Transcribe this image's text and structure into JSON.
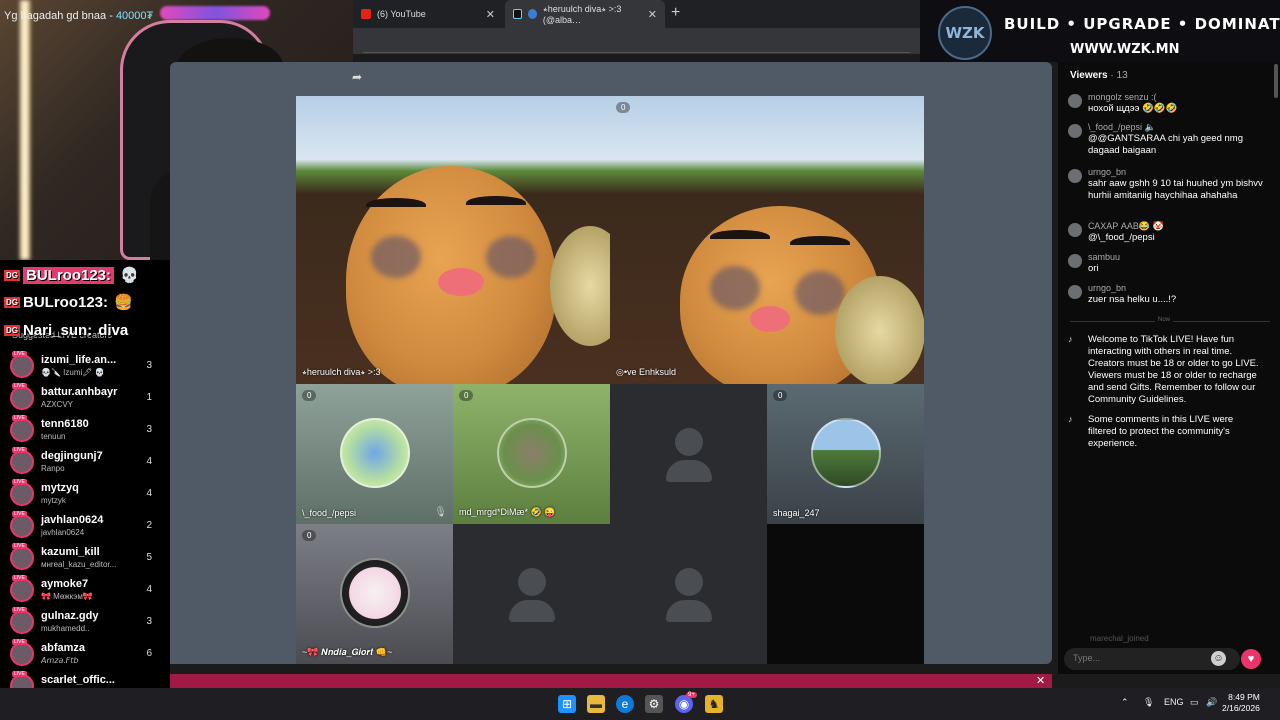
{
  "browser": {
    "tabs": [
      {
        "label": "(6) YouTube",
        "close": "✕"
      },
      {
        "label": "⭒heruulch diva⭒ >:3 (@alba…",
        "close": "✕"
      }
    ],
    "new_tab": "+"
  },
  "overlay": {
    "logo": "WZK",
    "slogan": "BUILD • UPGRADE • DOMINATE",
    "site": "WWW.WZK.MN",
    "donation_name": "Yg bagadah gd bnaa - ",
    "donation_amount": "40000₮"
  },
  "alerts": [
    {
      "badge": "DG",
      "name": "BULroo123:",
      "emote": "💀"
    },
    {
      "badge": "DG",
      "name": "BULroo123:",
      "emote": "🍔"
    },
    {
      "badge": "DG",
      "name": "Nari_sun:",
      "message": "diva"
    }
  ],
  "stage": {
    "main_tiles": [
      {
        "label": "⭒heruulch diva⭒ >:3",
        "count": ""
      },
      {
        "label": "◎•ve Enhksuld",
        "count": "0"
      }
    ],
    "guests": [
      {
        "label": "\\_food_/pepsi",
        "count": "0"
      },
      {
        "label": "md_mrgd*DiMæ* 🤣 😜",
        "count": "0"
      },
      {
        "label": "",
        "count": ""
      },
      {
        "label": "shagai_247",
        "count": "0"
      },
      {
        "label": "~🎀 𝑵𝒏𝒅𝒊𝒂_𝑮𝒊𝒐𝒓𝒕 👊~",
        "count": "0"
      },
      {
        "label": "",
        "count": ""
      },
      {
        "label": "",
        "count": ""
      },
      {
        "label": "",
        "count": ""
      }
    ]
  },
  "suggested": {
    "title": "Suggested LIVE creators",
    "live_badge": "LIVE",
    "creators": [
      {
        "name": "izumi_life.an...",
        "sub": "💀🔪 Izumi🖋 💀",
        "count": "3"
      },
      {
        "name": "battur.anhbayr",
        "sub": "AZXCVY",
        "count": "1"
      },
      {
        "name": "tenn6180",
        "sub": "tenuun",
        "count": "3"
      },
      {
        "name": "degjingunj7",
        "sub": "Ranpo",
        "count": "4"
      },
      {
        "name": "mytzyq",
        "sub": "mytzyk",
        "count": "4"
      },
      {
        "name": "javhlan0624",
        "sub": "javhlan0624",
        "count": "2"
      },
      {
        "name": "kazumi_kill",
        "sub": "мнreal_kazu_editor...",
        "count": "5"
      },
      {
        "name": "aymoke7",
        "sub": "🎀 Мөжкэм🎀",
        "count": "4"
      },
      {
        "name": "gulnaz.gdy",
        "sub": "mukhamedd..",
        "count": "3"
      },
      {
        "name": "abfamza",
        "sub": "𝘈𝘮𝘻𝘢.𝘍𝘵𝘣",
        "count": "6"
      },
      {
        "name": "scarlet_offic...",
        "sub": "",
        "count": ""
      }
    ]
  },
  "chat": {
    "viewers_label": "Viewers",
    "viewers_count": "· 13",
    "messages": [
      {
        "user": "mongolz senzu :(",
        "text": "нохой щдээ 🤣🤣🤣"
      },
      {
        "user": "\\_food_/pepsi 🔈",
        "text": "@@GANTSARAA chi yah geed nmg dagaad baigaan"
      },
      {
        "user": "urngo_bn",
        "text": "sahr aaw gshh 9 10 tai huuhed ym bishvv hurhii amitaniig haychihaa ahahaha"
      },
      {
        "user": "САХАР ААВ😂 🤡",
        "text": "@\\_food_/pepsi"
      },
      {
        "user": "sambuu",
        "text": "ori"
      },
      {
        "user": "urngo_bn",
        "text": "zuer nsa helku u....!?"
      }
    ],
    "divider_label": "Now",
    "system": [
      {
        "text": "Welcome to TikTok LIVE! Have fun interacting with others in real time. Creators must be 18 or older to go LIVE. Viewers must be 18 or older to recharge and send Gifts. Remember to follow our Community Guidelines."
      },
      {
        "text": "Some comments in this LIVE were filtered to protect the community's experience."
      }
    ],
    "joined": "marechal_joined",
    "input_placeholder": "Type...",
    "emoji": "☺",
    "heart": "♥"
  },
  "taskbar": {
    "lang": "ENG",
    "time": "8:49 PM",
    "date": "2/16/2026",
    "discord_badge": "9+"
  },
  "colors": {
    "accent": "#e9356b",
    "stage_bg": "#4f5a66"
  }
}
